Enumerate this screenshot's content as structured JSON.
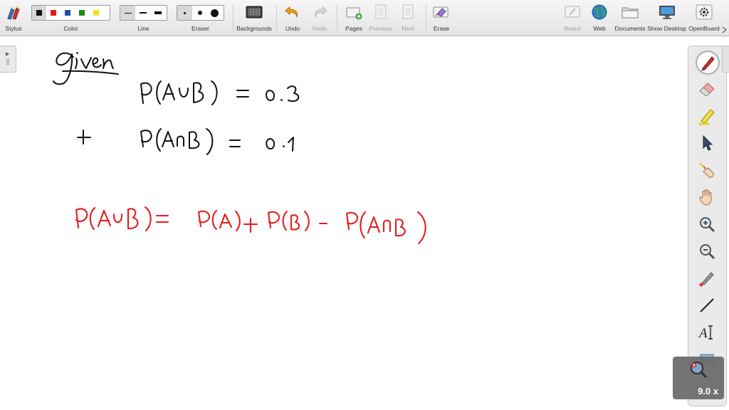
{
  "toolbar": {
    "stylus": "Stylus",
    "color": "Color",
    "line": "Line",
    "eraser": "Eraser",
    "backgrounds": "Backgrounds",
    "undo": "Undo",
    "redo": "Redo",
    "pages": "Pages",
    "previous": "Previous",
    "next": "Next",
    "erase": "Erase",
    "board": "Board",
    "web": "Web",
    "documents": "Documents",
    "show_desktop": "Show Desktop",
    "openboard": "OpenBoard"
  },
  "colors": {
    "swatches": [
      "#111111",
      "#e01b1b",
      "#1f4fa0",
      "#1a8a1a",
      "#f2e21a"
    ],
    "selected_index": 0,
    "ink_black": "#111111",
    "ink_red": "#e41c1c"
  },
  "line_widths": {
    "selected_index": 0
  },
  "eraser_sizes": {
    "selected_index": 0
  },
  "zoom": {
    "label": "9.0 x"
  },
  "board_content": {
    "black": [
      "given",
      "P(A∪B) = 0.3",
      "+",
      "P(A∩B) = 0.1"
    ],
    "red": [
      "P(A∪B) = P(A) + P(B) - P(A∩B)"
    ]
  },
  "palette_tools": [
    "pen",
    "eraser",
    "marker",
    "selector",
    "interactor",
    "hand",
    "zoom-in",
    "zoom-out",
    "laser-pointer",
    "line",
    "text",
    "capture"
  ]
}
